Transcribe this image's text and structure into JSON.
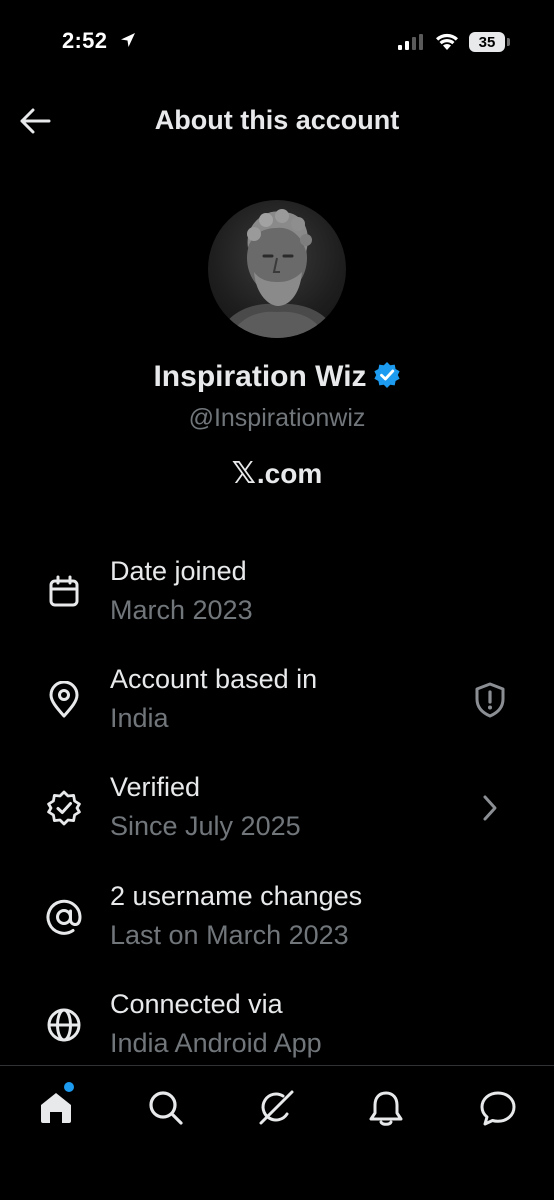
{
  "status_bar": {
    "time": "2:52",
    "battery": "35",
    "icons": [
      "location-arrow-icon",
      "signal-icon",
      "wifi-icon",
      "battery-icon"
    ]
  },
  "header": {
    "title": "About this account",
    "back_icon": "arrow-left-icon"
  },
  "profile": {
    "name": "Inspiration Wiz",
    "handle": "@Inspirationwiz",
    "domain_text": ".com",
    "domain_logo": "𝕏",
    "verified_icon": "verified-badge-icon"
  },
  "rows": [
    {
      "icon": "calendar-icon",
      "title": "Date joined",
      "subtitle": "March 2023"
    },
    {
      "icon": "location-pin-icon",
      "title": "Account based in",
      "subtitle": "India",
      "trail": "shield-alert-icon"
    },
    {
      "icon": "verified-outline-icon",
      "title": "Verified",
      "subtitle": "Since July 2025",
      "trail": "chevron-right-icon"
    },
    {
      "icon": "at-sign-icon",
      "title": "2 username changes",
      "subtitle": "Last on March 2023"
    },
    {
      "icon": "globe-icon",
      "title": "Connected via",
      "subtitle": "India Android App"
    }
  ],
  "bottom_nav": {
    "items": [
      "home-icon",
      "search-icon",
      "grok-icon",
      "notifications-icon",
      "messages-icon"
    ]
  },
  "colors": {
    "background": "#000000",
    "text_primary": "#e7e9ea",
    "text_secondary": "#71767b",
    "accent": "#1d9bf0"
  }
}
